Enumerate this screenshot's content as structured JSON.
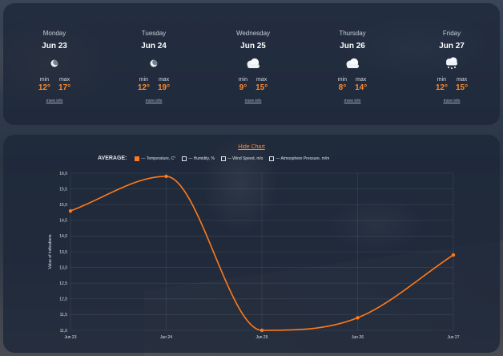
{
  "forecast": {
    "days": [
      {
        "name": "Monday",
        "date": "Jun 23",
        "icon": "moon-icon",
        "min_label": "min",
        "min": "12°",
        "max_label": "max",
        "max": "17°",
        "more": "more info"
      },
      {
        "name": "Tuesday",
        "date": "Jun 24",
        "icon": "moon-icon",
        "min_label": "min",
        "min": "12°",
        "max_label": "max",
        "max": "19°",
        "more": "more info"
      },
      {
        "name": "Wednesday",
        "date": "Jun 25",
        "icon": "cloud-icon",
        "min_label": "min",
        "min": "9°",
        "max_label": "max",
        "max": "15°",
        "more": "more info"
      },
      {
        "name": "Thursday",
        "date": "Jun 26",
        "icon": "cloud-icon",
        "min_label": "min",
        "min": "8°",
        "max_label": "max",
        "max": "14°",
        "more": "more info"
      },
      {
        "name": "Friday",
        "date": "Jun 27",
        "icon": "snow-cloud-icon",
        "min_label": "min",
        "min": "12°",
        "max_label": "max",
        "max": "15°",
        "more": "more info"
      }
    ]
  },
  "chart_panel": {
    "hide_label": "Hide Chart",
    "legend_title": "AVERAGE:",
    "legend": [
      {
        "label": "— Temperature, C°",
        "checked": true
      },
      {
        "label": "— Humidity, %",
        "checked": false
      },
      {
        "label": "— Wind Speed, m/s",
        "checked": false
      },
      {
        "label": "— Atmosphere Pressure, m/m",
        "checked": false
      }
    ]
  },
  "colors": {
    "accent": "#ff7a1a",
    "panel": "#1c2638"
  },
  "chart_data": {
    "type": "line",
    "categories": [
      "Jun 23",
      "Jun 24",
      "Jun 25",
      "Jun 26",
      "Jun 27"
    ],
    "series": [
      {
        "name": "Temperature, C°",
        "values": [
          14.8,
          15.9,
          11.0,
          11.4,
          13.4
        ]
      }
    ],
    "ylabel": "Value of indications",
    "yticks": [
      "16,0",
      "15,5",
      "15,0",
      "14,5",
      "14,0",
      "13,5",
      "13,0",
      "12,5",
      "12,0",
      "11,5",
      "11,0"
    ],
    "ylim": [
      11.0,
      16.0
    ],
    "grid": true
  }
}
